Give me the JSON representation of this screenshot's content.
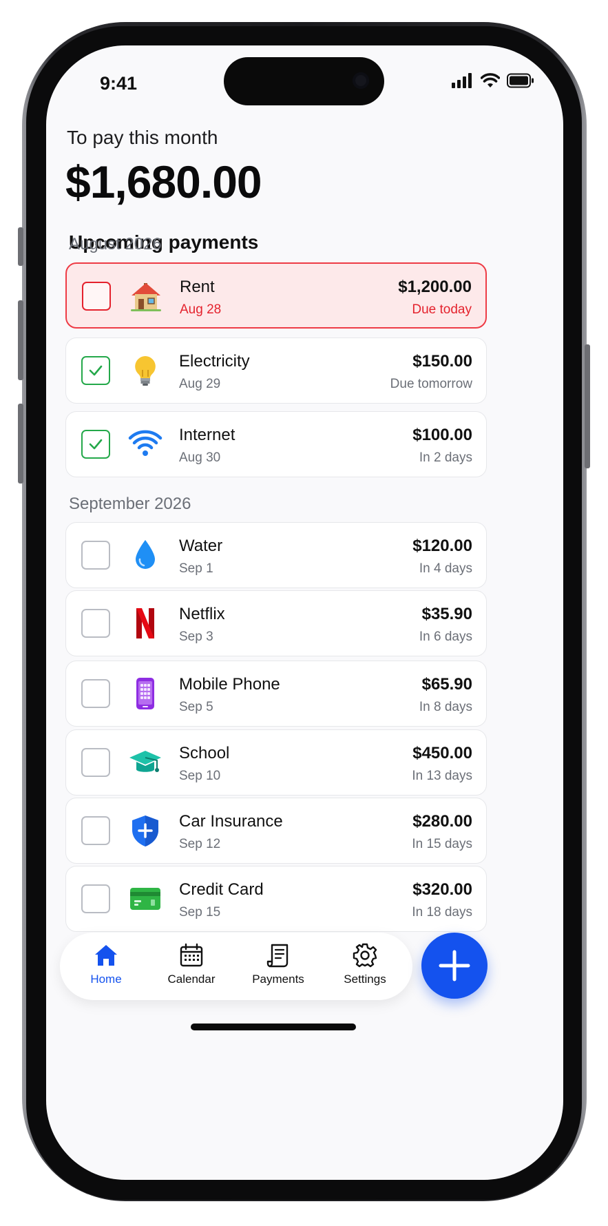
{
  "status": {
    "time": "9:41"
  },
  "summary": {
    "label": "To pay this month",
    "amount": "$1,680.00"
  },
  "section_title": "Upcoming payments",
  "months": [
    {
      "label": "August 2026"
    },
    {
      "label": "September 2026"
    }
  ],
  "payments": [
    {
      "name": "Rent",
      "date": "Aug 28",
      "amount": "$1,200.00",
      "due": "Due today",
      "checked": false,
      "icon": "house-icon"
    },
    {
      "name": "Electricity",
      "date": "Aug 29",
      "amount": "$150.00",
      "due": "Due tomorrow",
      "checked": true,
      "icon": "lightbulb-icon"
    },
    {
      "name": "Internet",
      "date": "Aug 30",
      "amount": "$100.00",
      "due": "In 2 days",
      "checked": true,
      "icon": "wifi-icon"
    },
    {
      "name": "Water",
      "date": "Sep 1",
      "amount": "$120.00",
      "due": "In 4 days",
      "checked": false,
      "icon": "water-drop-icon"
    },
    {
      "name": "Netflix",
      "date": "Sep 3",
      "amount": "$35.90",
      "due": "In 6 days",
      "checked": false,
      "icon": "netflix-icon"
    },
    {
      "name": "Mobile Phone",
      "date": "Sep 5",
      "amount": "$65.90",
      "due": "In 8 days",
      "checked": false,
      "icon": "mobile-phone-icon"
    },
    {
      "name": "School",
      "date": "Sep 10",
      "amount": "$450.00",
      "due": "In 13 days",
      "checked": false,
      "icon": "graduation-cap-icon"
    },
    {
      "name": "Car Insurance",
      "date": "Sep 12",
      "amount": "$280.00",
      "due": "In 15 days",
      "checked": false,
      "icon": "shield-icon"
    },
    {
      "name": "Credit Card",
      "date": "Sep 15",
      "amount": "$320.00",
      "due": "In 18 days",
      "checked": false,
      "icon": "credit-card-icon"
    }
  ],
  "tabs": [
    {
      "label": "Home",
      "icon": "home-icon",
      "active": true
    },
    {
      "label": "Calendar",
      "icon": "calendar-icon",
      "active": false
    },
    {
      "label": "Payments",
      "icon": "receipt-icon",
      "active": false
    },
    {
      "label": "Settings",
      "icon": "gear-icon",
      "active": false
    }
  ],
  "colors": {
    "accent": "#1452ee",
    "due": "#e4222d",
    "done": "#24a84a"
  }
}
